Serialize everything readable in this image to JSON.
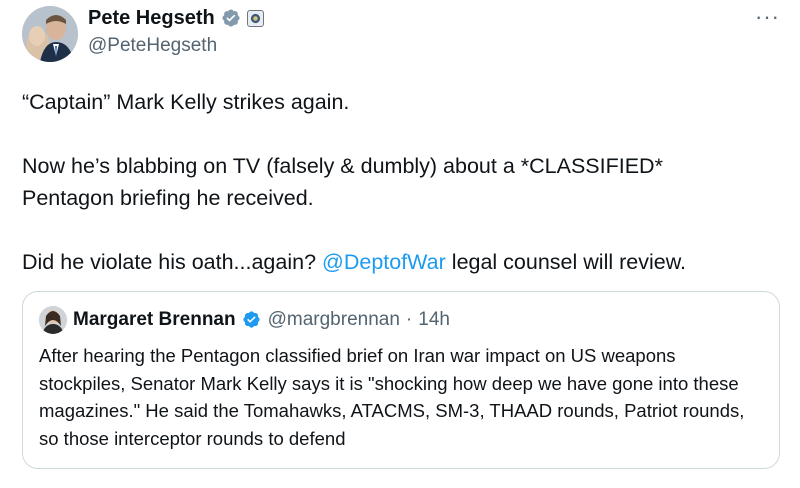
{
  "author": {
    "display_name": "Pete Hegseth",
    "handle": "@PeteHegseth",
    "badge_color": "#1d9bf0",
    "badges": [
      "verified-checkmark-icon",
      "government-affiliation-icon"
    ]
  },
  "menu": {
    "more_label": "···"
  },
  "tweet": {
    "line1": "“Captain” Mark Kelly strikes again.",
    "line2": "Now he’s blabbing on TV (falsely & dumbly) about a *CLASSIFIED* Pentagon briefing he received.",
    "line3_before": "Did he violate his oath...again? ",
    "line3_mention": "@DeptofWar",
    "line3_after": " legal counsel will review."
  },
  "quote": {
    "display_name": "Margaret Brennan",
    "handle": "@margbrennan",
    "separator": "·",
    "time": "14h",
    "text": "After hearing the Pentagon classified brief on Iran war impact on US weapons stockpiles, Senator Mark Kelly says it is \"shocking how deep we have gone into these magazines.\" He said the Tomahawks, ATACMS, SM-3, THAAD rounds, Patriot rounds, so those interceptor rounds to defend"
  },
  "colors": {
    "mention": "#1d9bf0",
    "secondary_text": "#536471",
    "border": "#cfd9de"
  }
}
